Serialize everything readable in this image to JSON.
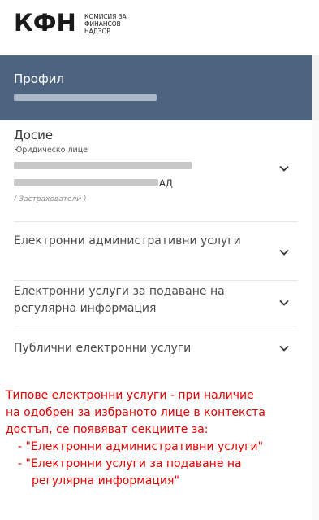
{
  "header": {
    "logo_text": "КФН",
    "logo_sub_1": "КОМИСИЯ ЗА",
    "logo_sub_2": "ФИНАНСОВ",
    "logo_sub_3": "НАДЗОР"
  },
  "profile": {
    "title": "Профил"
  },
  "dossier": {
    "title": "Досие",
    "entity_type": "Юридическо лице",
    "company_suffix": "АД",
    "category": "( Застрахователи )"
  },
  "menu": {
    "items": [
      {
        "label": "Електронни административни услуги"
      },
      {
        "label": "Електронни услуги за подаване на регулярна информация"
      },
      {
        "label": "Публични електронни услуги"
      }
    ]
  },
  "note": {
    "line1": "Типове електронни услуги - при наличие",
    "line2": "на одобрен за избраното лице в контекста",
    "line3": "достъп, се появяват секциите за:",
    "bullet1": "- \"Електронни административни услуги\"",
    "bullet2a": "- \"Електронни услуги за подаване на",
    "bullet2b": "регулярна информация\""
  },
  "colors": {
    "profile_bg": "#4d6481",
    "note_text": "#e60000"
  }
}
